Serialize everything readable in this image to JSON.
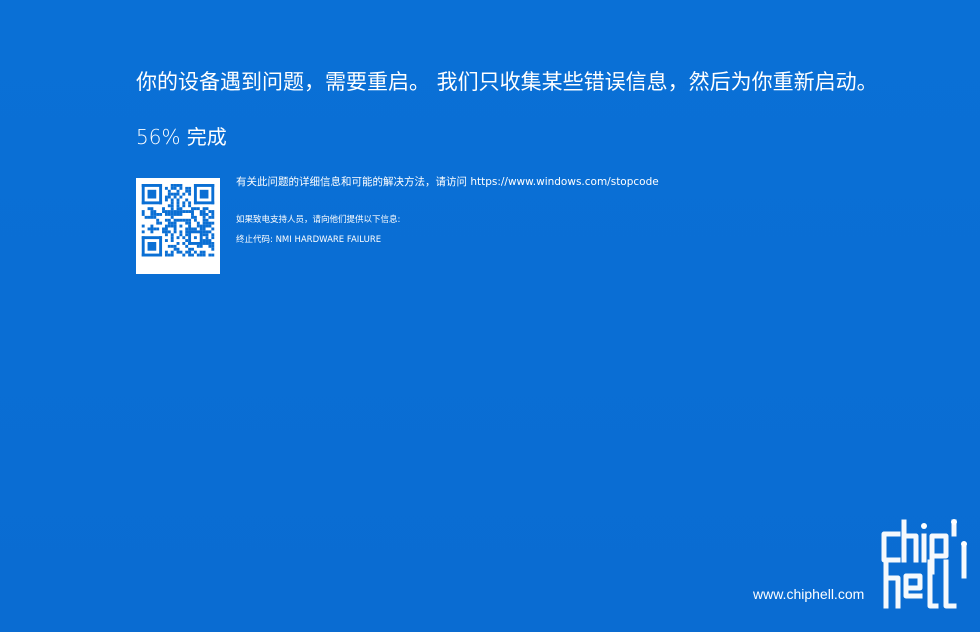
{
  "bsod": {
    "headline": "你的设备遇到问题，需要重启。 我们只收集某些错误信息，然后为你重新启动。",
    "progress_percent": 56,
    "progress_text": "56% 完成",
    "info_line": "有关此问题的详细信息和可能的解决方法，请访问 https://www.windows.com/stopcode",
    "support_line": "如果致电支持人员，请向他们提供以下信息:",
    "stop_code_line": "终止代码: NMI HARDWARE FAILURE"
  },
  "watermark": {
    "site": "www.chiphell.com",
    "logo_text": "chip hell"
  },
  "colors": {
    "background": "#0a6fd4",
    "text": "#ffffff",
    "qr_dark": "#0a6fd4"
  },
  "icons": {
    "qr": "qr-code-icon",
    "logo": "chiphell-logo-icon"
  }
}
